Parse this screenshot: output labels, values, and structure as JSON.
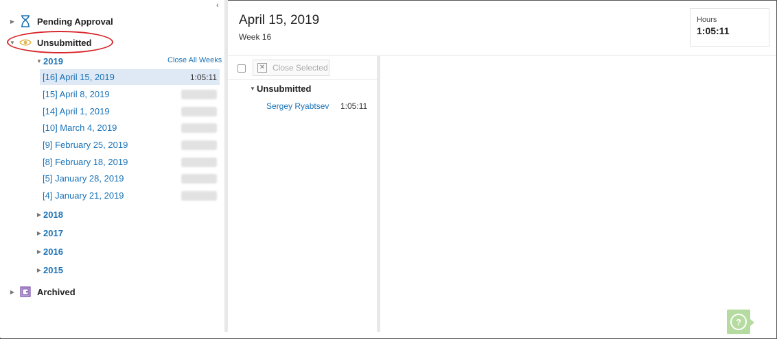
{
  "tree": {
    "pending_label": "Pending Approval",
    "unsubmitted_label": "Unsubmitted",
    "archived_label": "Archived",
    "close_all_weeks": "Close All Weeks",
    "years_open": "2019",
    "weeks": [
      {
        "label": "[16] April 15, 2019",
        "hours": "1:05:11"
      },
      {
        "label": "[15] April 8, 2019",
        "hours": ""
      },
      {
        "label": "[14] April 1, 2019",
        "hours": ""
      },
      {
        "label": "[10] March 4, 2019",
        "hours": ""
      },
      {
        "label": "[9] February 25, 2019",
        "hours": ""
      },
      {
        "label": "[8] February 18, 2019",
        "hours": ""
      },
      {
        "label": "[5] January 28, 2019",
        "hours": ""
      },
      {
        "label": "[4] January 21, 2019",
        "hours": ""
      }
    ],
    "years_closed": [
      "2018",
      "2017",
      "2016",
      "2015"
    ]
  },
  "header": {
    "title": "April 15, 2019",
    "week": "Week 16",
    "hours_label": "Hours",
    "hours_value": "1:05:11"
  },
  "list": {
    "close_selected": "Close Selected",
    "group_label": "Unsubmitted",
    "member_name": "Sergey Ryabtsev",
    "member_hours": "1:05:11"
  },
  "help": {
    "glyph": "?"
  }
}
